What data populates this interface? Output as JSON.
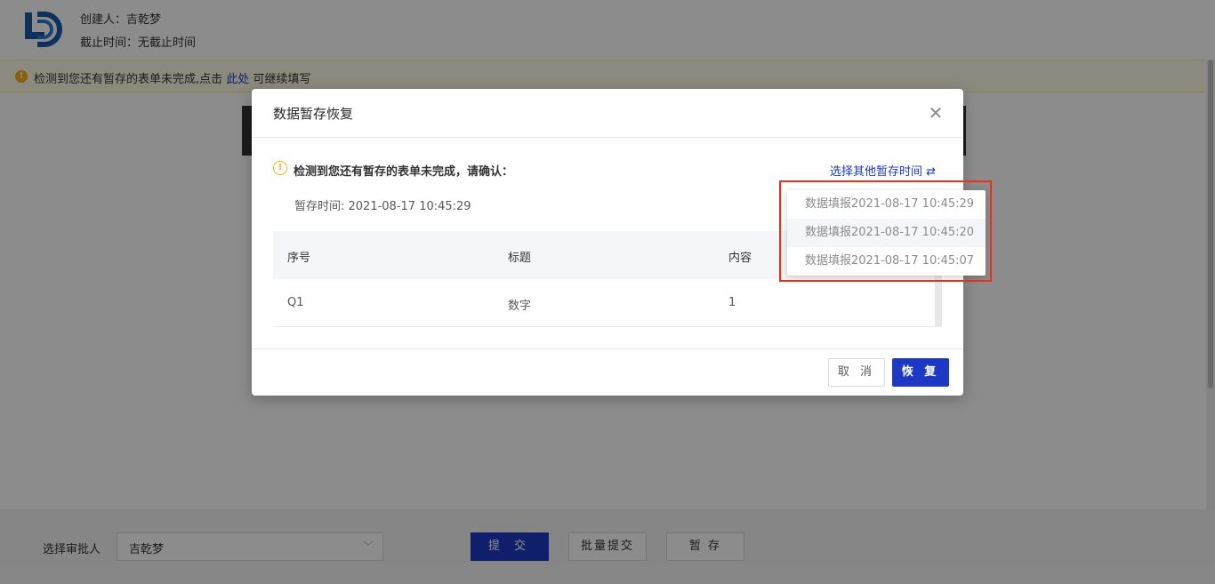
{
  "header": {
    "creator_label": "创建人：吉乾梦",
    "deadline_label": "截止时间：无截止时间"
  },
  "notice": {
    "prefix": "检测到您还有暂存的表单未完成,点击",
    "link": "此处",
    "suffix": "可继续填写"
  },
  "footer": {
    "approver_label": "选择审批人",
    "approver_value": "吉乾梦",
    "submit_label": "提 交",
    "batch_submit_label": "批量提交",
    "save_label": "暂 存"
  },
  "modal": {
    "title": "数据暂存恢复",
    "warning": "检测到您还有暂存的表单未完成，请确认：",
    "other_time_link": "选择其他暂存时间",
    "saved_time": "暂存时间: 2021-08-17 10:45:29",
    "table": {
      "headers": [
        "序号",
        "标题",
        "内容"
      ],
      "rows": [
        [
          "Q1",
          "数字",
          "1"
        ]
      ]
    },
    "cancel_label": "取 消",
    "restore_label": "恢 复"
  },
  "dropdown": {
    "options": [
      "数据填报2021-08-17 10:45:29",
      "数据填报2021-08-17 10:45:20",
      "数据填报2021-08-17 10:45:07"
    ]
  },
  "colors": {
    "primary": "#1d39c4",
    "warning": "#faad14",
    "highlight": "#e8301c"
  }
}
